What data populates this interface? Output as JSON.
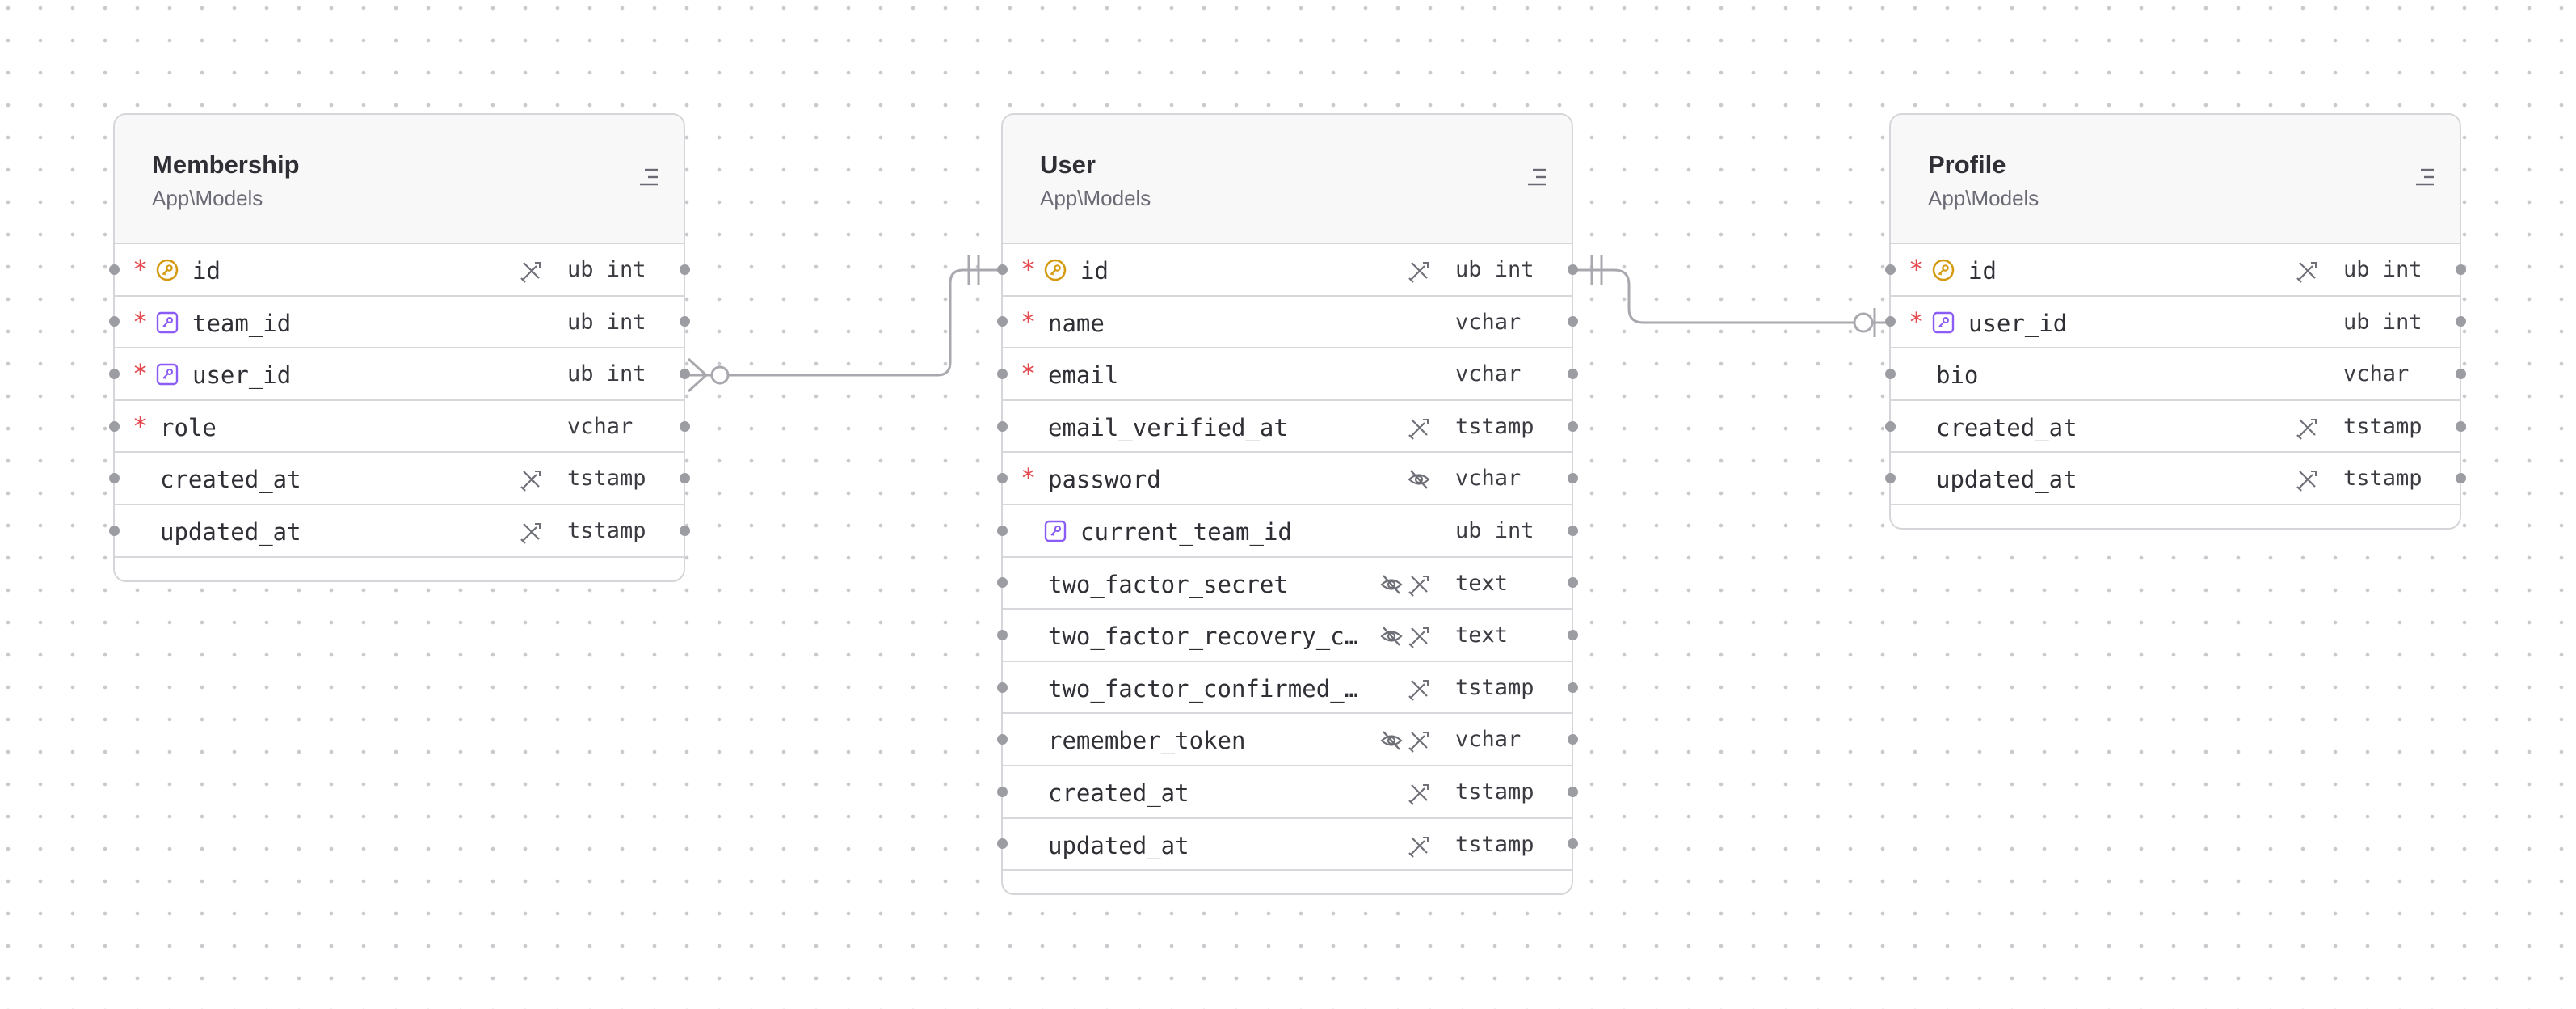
{
  "tables": [
    {
      "name": "Membership",
      "namespace": "App\\Models",
      "columns": [
        {
          "name": "id",
          "type": "ub int",
          "required": true,
          "key": "primary",
          "flags": [
            "auto-increment-icon"
          ]
        },
        {
          "name": "team_id",
          "type": "ub int",
          "required": true,
          "key": "foreign",
          "flags": []
        },
        {
          "name": "user_id",
          "type": "ub int",
          "required": true,
          "key": "foreign",
          "flags": []
        },
        {
          "name": "role",
          "type": "vchar",
          "required": true,
          "key": null,
          "flags": []
        },
        {
          "name": "created_at",
          "type": "tstamp",
          "required": false,
          "key": null,
          "flags": [
            "auto-increment-icon"
          ]
        },
        {
          "name": "updated_at",
          "type": "tstamp",
          "required": false,
          "key": null,
          "flags": [
            "auto-increment-icon"
          ]
        }
      ]
    },
    {
      "name": "User",
      "namespace": "App\\Models",
      "columns": [
        {
          "name": "id",
          "type": "ub int",
          "required": true,
          "key": "primary",
          "flags": [
            "auto-increment-icon"
          ]
        },
        {
          "name": "name",
          "type": "vchar",
          "required": true,
          "key": null,
          "flags": []
        },
        {
          "name": "email",
          "type": "vchar",
          "required": true,
          "key": null,
          "flags": []
        },
        {
          "name": "email_verified_at",
          "type": "tstamp",
          "required": false,
          "key": null,
          "flags": [
            "auto-increment-icon"
          ]
        },
        {
          "name": "password",
          "type": "vchar",
          "required": true,
          "key": null,
          "flags": [
            "hidden-icon"
          ]
        },
        {
          "name": "current_team_id",
          "type": "ub int",
          "required": false,
          "key": "foreign",
          "flags": []
        },
        {
          "name": "two_factor_secret",
          "type": "text",
          "required": false,
          "key": null,
          "flags": [
            "hidden-icon",
            "auto-increment-icon"
          ]
        },
        {
          "name": "two_factor_recovery_codes",
          "type": "text",
          "required": false,
          "key": null,
          "flags": [
            "hidden-icon",
            "auto-increment-icon"
          ]
        },
        {
          "name": "two_factor_confirmed_at",
          "type": "tstamp",
          "required": false,
          "key": null,
          "flags": [
            "auto-increment-icon"
          ]
        },
        {
          "name": "remember_token",
          "type": "vchar",
          "required": false,
          "key": null,
          "flags": [
            "hidden-icon",
            "auto-increment-icon"
          ]
        },
        {
          "name": "created_at",
          "type": "tstamp",
          "required": false,
          "key": null,
          "flags": [
            "auto-increment-icon"
          ]
        },
        {
          "name": "updated_at",
          "type": "tstamp",
          "required": false,
          "key": null,
          "flags": [
            "auto-increment-icon"
          ]
        }
      ]
    },
    {
      "name": "Profile",
      "namespace": "App\\Models",
      "columns": [
        {
          "name": "id",
          "type": "ub int",
          "required": true,
          "key": "primary",
          "flags": [
            "auto-increment-icon"
          ]
        },
        {
          "name": "user_id",
          "type": "ub int",
          "required": true,
          "key": "foreign",
          "flags": []
        },
        {
          "name": "bio",
          "type": "vchar",
          "required": false,
          "key": null,
          "flags": []
        },
        {
          "name": "created_at",
          "type": "tstamp",
          "required": false,
          "key": null,
          "flags": [
            "auto-increment-icon"
          ]
        },
        {
          "name": "updated_at",
          "type": "tstamp",
          "required": false,
          "key": null,
          "flags": [
            "auto-increment-icon"
          ]
        }
      ]
    }
  ],
  "relations": [
    {
      "from": "Membership.user_id",
      "to": "User.id",
      "from_cardinality": "zero-or-many",
      "to_cardinality": "exactly-one"
    },
    {
      "from": "User.id",
      "to": "Profile.user_id",
      "from_cardinality": "exactly-one",
      "to_cardinality": "zero-or-one"
    }
  ],
  "colors": {
    "required": "#e5484d",
    "primary_key": "#d49a10",
    "foreign_key": "#8b5cf6",
    "relation_line": "#a8a8ae",
    "border": "#d6d6da"
  }
}
